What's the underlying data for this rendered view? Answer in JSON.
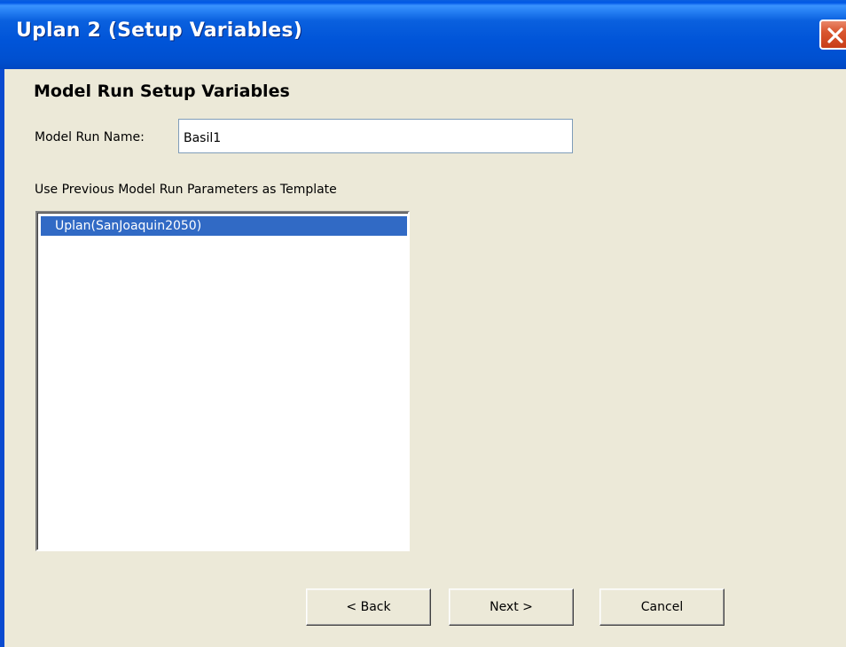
{
  "window": {
    "title": "Uplan 2 (Setup Variables)",
    "close_icon": "close-icon"
  },
  "form": {
    "heading": "Model Run Setup Variables",
    "run_name_label": "Model Run Name:",
    "run_name_value": "Basil1",
    "template_label": "Use Previous Model Run Parameters as Template",
    "template_items": [
      {
        "label": "Uplan(SanJoaquin2050)",
        "selected": true
      }
    ]
  },
  "buttons": {
    "back": "< Back",
    "next": "Next >",
    "cancel": "Cancel"
  },
  "colors": {
    "titlebar": "#0054d8",
    "dialog_background": "#ece9d8",
    "selection": "#316ac5",
    "close_button": "#d9562f"
  }
}
